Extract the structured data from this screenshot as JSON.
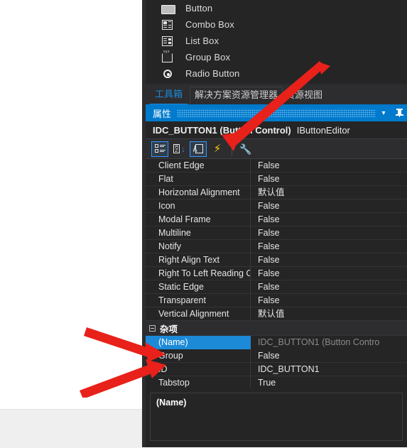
{
  "toolbox": {
    "items": [
      {
        "label": "Button",
        "icon": "button-icon"
      },
      {
        "label": "Combo Box",
        "icon": "combo-box-icon"
      },
      {
        "label": "List Box",
        "icon": "list-box-icon"
      },
      {
        "label": "Group Box",
        "icon": "group-box-icon"
      },
      {
        "label": "Radio Button",
        "icon": "radio-button-icon"
      }
    ]
  },
  "tabs": [
    {
      "label": "工具箱",
      "active": true
    },
    {
      "label": "解决方案资源管理器",
      "active": false
    },
    {
      "label": "资源视图",
      "active": false
    }
  ],
  "properties_panel": {
    "title": "属性",
    "dropdown_icon": "chevron-down-icon",
    "pin_icon": "pin-icon",
    "object_name": "IDC_BUTTON1 (Button Control)",
    "object_editor": "IButtonEditor",
    "accent_color": "#007acc",
    "selection_color": "#1d8ad8",
    "background_color": "#252526",
    "toolbar": [
      {
        "name": "categorized-view-button",
        "icon": "categorized-icon",
        "selected": true
      },
      {
        "name": "alphabetical-sort-button",
        "icon": "sort-az-icon",
        "selected": false
      },
      {
        "name": "property-pages-button",
        "icon": "property-pages-icon",
        "selected": true
      },
      {
        "name": "events-button",
        "icon": "lightning-bolt-icon",
        "selected": false
      },
      {
        "name": "settings-button",
        "icon": "wrench-icon",
        "selected": false,
        "disabled": true
      }
    ],
    "rows": [
      {
        "key": "Client Edge",
        "value": "False"
      },
      {
        "key": "Flat",
        "value": "False"
      },
      {
        "key": "Horizontal Alignment",
        "value": "默认值"
      },
      {
        "key": "Icon",
        "value": "False"
      },
      {
        "key": "Modal Frame",
        "value": "False"
      },
      {
        "key": "Multiline",
        "value": "False"
      },
      {
        "key": "Notify",
        "value": "False"
      },
      {
        "key": "Right Align Text",
        "value": "False"
      },
      {
        "key": "Right To Left Reading Order",
        "value": "False"
      },
      {
        "key": "Static Edge",
        "value": "False"
      },
      {
        "key": "Transparent",
        "value": "False"
      },
      {
        "key": "Vertical Alignment",
        "value": "默认值"
      }
    ],
    "category": {
      "label": "杂项",
      "expander_icon": "collapse-icon",
      "rows": [
        {
          "key": "(Name)",
          "value": "IDC_BUTTON1 (Button Contro",
          "selected": true
        },
        {
          "key": "Group",
          "value": "False",
          "selected": false
        },
        {
          "key": "ID",
          "value": "IDC_BUTTON1",
          "selected": false
        },
        {
          "key": "Tabstop",
          "value": "True",
          "selected": false
        }
      ]
    },
    "description_title": "(Name)"
  },
  "annotations": {
    "arrow_color": "#e8211a",
    "arrows": [
      {
        "name": "arrow-to-property-pages-button"
      },
      {
        "name": "arrow-to-group-row"
      },
      {
        "name": "arrow-to-id-row"
      }
    ]
  }
}
